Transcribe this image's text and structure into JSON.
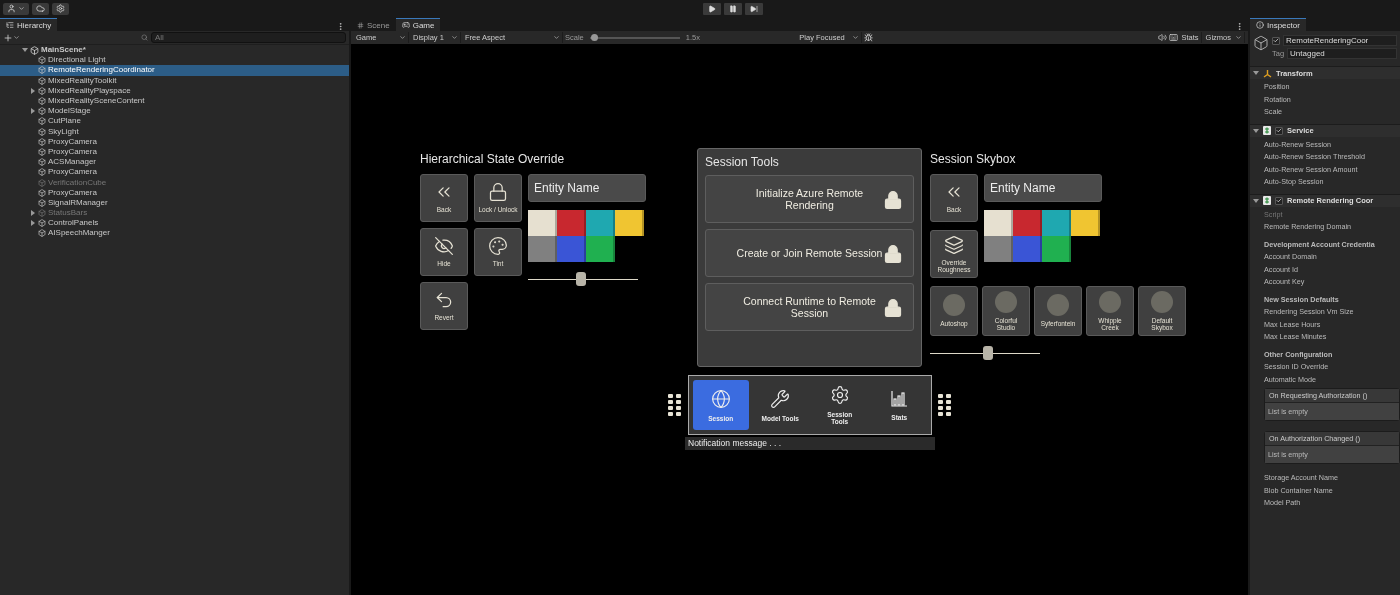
{
  "hierarchy": {
    "tab": {
      "label": "Hierarchy",
      "selected": true
    },
    "search": {
      "placeholder": "All"
    },
    "scene": {
      "name": "MainScene*",
      "expanded": true,
      "children": [
        {
          "name": "Directional Light",
          "selected": false,
          "active": true,
          "expandable": false
        },
        {
          "name": "RemoteRenderingCoordinator",
          "selected": true,
          "active": true,
          "expandable": false
        },
        {
          "name": "MixedRealityToolkit",
          "selected": false,
          "active": true,
          "expandable": false
        },
        {
          "name": "MixedRealityPlayspace",
          "selected": false,
          "active": true,
          "expandable": true
        },
        {
          "name": "MixedRealitySceneContent",
          "selected": false,
          "active": true,
          "expandable": false
        },
        {
          "name": "ModelStage",
          "selected": false,
          "active": true,
          "expandable": true
        },
        {
          "name": "CutPlane",
          "selected": false,
          "active": true,
          "expandable": false
        },
        {
          "name": "SkyLight",
          "selected": false,
          "active": true,
          "expandable": false
        },
        {
          "name": "ProxyCamera",
          "selected": false,
          "active": true,
          "expandable": false
        },
        {
          "name": "ProxyCamera",
          "selected": false,
          "active": true,
          "expandable": false
        },
        {
          "name": "ACSManager",
          "selected": false,
          "active": true,
          "expandable": false
        },
        {
          "name": "ProxyCamera",
          "selected": false,
          "active": true,
          "expandable": false
        },
        {
          "name": "VerificationCube",
          "selected": false,
          "active": false,
          "expandable": false
        },
        {
          "name": "ProxyCamera",
          "selected": false,
          "active": true,
          "expandable": false
        },
        {
          "name": "SignalRManager",
          "selected": false,
          "active": true,
          "expandable": false
        },
        {
          "name": "StatusBars",
          "selected": false,
          "active": false,
          "expandable": true
        },
        {
          "name": "ControlPanels",
          "selected": false,
          "active": true,
          "expandable": true
        },
        {
          "name": "AISpeechManger",
          "selected": false,
          "active": true,
          "expandable": false
        }
      ]
    }
  },
  "game": {
    "tabs": [
      {
        "label": "Scene",
        "selected": false
      },
      {
        "label": "Game",
        "selected": true
      }
    ],
    "toolbar": {
      "mode": "Game",
      "display": "Display 1",
      "aspect": "Free Aspect",
      "scale_label": "Scale",
      "scale": {
        "level": 0.05
      },
      "scale_reading": "1.5x",
      "play_mode": "Play Focused",
      "stats": "Stats",
      "gizmos": "Gizmos"
    },
    "left_panel": {
      "title": "Hierarchical State Override",
      "entity_name": "Entity Name",
      "tiles": [
        {
          "kind": "back",
          "label": "Back"
        },
        {
          "kind": "lock",
          "label": "Lock / Unlock"
        },
        {
          "kind": "hide",
          "label": "Hide"
        },
        {
          "kind": "tint",
          "label": "Tint"
        },
        {
          "kind": "revert",
          "label": "Revert"
        }
      ],
      "swatches": [
        {
          "color": "#e6e0d0"
        },
        {
          "color": "#c8282f"
        },
        {
          "color": "#1fa8b0"
        },
        {
          "color": "#f0c531"
        },
        {
          "color": "#808080"
        },
        {
          "color": "#3a55d6"
        },
        {
          "color": "#20b050"
        }
      ],
      "slider": {
        "level": 0.48
      }
    },
    "session_panel": {
      "title": "Session Tools",
      "actions": [
        {
          "label": "Initialize Azure Remote Rendering",
          "locked": true
        },
        {
          "label": "Create or Join Remote Session",
          "locked": true
        },
        {
          "label": "Connect Runtime to Remote Session",
          "locked": true
        }
      ]
    },
    "right_panel": {
      "title": "Session Skybox",
      "entity_name": "Entity Name",
      "tiles": [
        {
          "kind": "back",
          "label": "Back"
        },
        {
          "kind": "roughness",
          "label": "Override Roughness"
        }
      ],
      "skyboxes": [
        {
          "label": "Autoshop"
        },
        {
          "label": "Colorful Studio"
        },
        {
          "label": "Syferfontein"
        },
        {
          "label": "Whipple Creek"
        },
        {
          "label": "Default Skybox"
        }
      ],
      "swatches": [
        {
          "color": "#e6e0d0"
        },
        {
          "color": "#c8282f"
        },
        {
          "color": "#1fa8b0"
        },
        {
          "color": "#f0c531"
        },
        {
          "color": "#808080"
        },
        {
          "color": "#3a55d6"
        },
        {
          "color": "#20b050"
        }
      ],
      "slider": {
        "level": 0.53
      }
    },
    "menu": {
      "items": [
        {
          "kind": "session",
          "label": "Session",
          "selected": true
        },
        {
          "kind": "model",
          "label": "Model Tools",
          "selected": false
        },
        {
          "kind": "session_tools",
          "label": "Session Tools",
          "selected": false
        },
        {
          "kind": "stats",
          "label": "Stats",
          "selected": false
        }
      ],
      "notification": "Notification message . . ."
    }
  },
  "inspector": {
    "tab": {
      "label": "Inspector",
      "selected": true
    },
    "object": {
      "active": true,
      "name": "RemoteRenderingCoor",
      "tag_label": "Tag",
      "tag": "Untagged"
    },
    "components": [
      {
        "kind": "transform",
        "title": "Transform",
        "expanded": true,
        "rows": [
          {
            "kind": "field",
            "label": "Position"
          },
          {
            "kind": "field",
            "label": "Rotation"
          },
          {
            "kind": "field",
            "label": "Scale"
          }
        ]
      },
      {
        "kind": "script",
        "title": "Service",
        "enabled": true,
        "expanded": true,
        "rows": [
          {
            "kind": "field",
            "label": "Auto-Renew Session"
          },
          {
            "kind": "field",
            "label": "Auto-Renew Session Threshold"
          },
          {
            "kind": "field",
            "label": "Auto-Renew Session Amount"
          },
          {
            "kind": "field",
            "label": "Auto-Stop Session"
          }
        ]
      },
      {
        "kind": "script",
        "title": "Remote Rendering Coor",
        "enabled": true,
        "expanded": true,
        "rows": [
          {
            "kind": "script_ref",
            "label": "Script"
          },
          {
            "kind": "field",
            "label": "Remote Rendering Domain"
          },
          {
            "kind": "header",
            "label": "Development Account Credentia"
          },
          {
            "kind": "field",
            "label": "Account Domain"
          },
          {
            "kind": "field",
            "label": "Account Id"
          },
          {
            "kind": "field",
            "label": "Account Key"
          },
          {
            "kind": "header",
            "label": "New Session Defaults"
          },
          {
            "kind": "field",
            "label": "Rendering Session Vm Size"
          },
          {
            "kind": "field",
            "label": "Max Lease Hours"
          },
          {
            "kind": "field",
            "label": "Max Lease Minutes"
          },
          {
            "kind": "header",
            "label": "Other Configuration"
          },
          {
            "kind": "field",
            "label": "Session ID Override"
          },
          {
            "kind": "field",
            "label": "Automatic Mode"
          },
          {
            "kind": "event",
            "label": "On Requesting Authorization ()",
            "empty_text": "List is empty"
          },
          {
            "kind": "event",
            "label": "On Authorization Changed ()",
            "empty_text": "List is empty"
          },
          {
            "kind": "field",
            "label": "Storage Account Name"
          },
          {
            "kind": "field",
            "label": "Blob Container Name"
          },
          {
            "kind": "field",
            "label": "Model Path"
          }
        ]
      }
    ]
  }
}
